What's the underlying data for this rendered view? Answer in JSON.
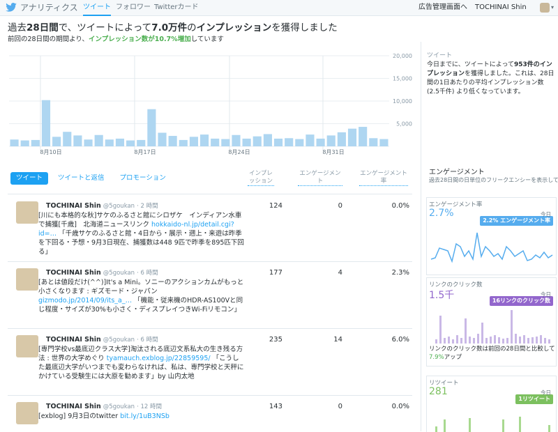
{
  "nav": {
    "brand": "アナリティクス",
    "tabs": [
      "ツイート",
      "フォロワー",
      "Twitterカード"
    ],
    "ads_manager": "広告管理画面へ",
    "user": "TOCHINAI Shin"
  },
  "summary": {
    "prefix": "過去",
    "days": "28日間",
    "middle": "で、ツイートによって",
    "impressions": "7.0万件",
    "middle2": "の",
    "impressions_word": "インプレッション",
    "suffix": "を獲得しました",
    "compare_prefix": "前回の28日間の期間より、",
    "compare_green": "インプレッション数が10.7%増加",
    "compare_suffix": "しています"
  },
  "chart_data": {
    "type": "bar",
    "x_labels": [
      "8月10日",
      "8月17日",
      "8月24日",
      "8月31日"
    ],
    "y_ticks": [
      "20,000",
      "15,000",
      "10,000",
      "5,000"
    ],
    "ylim": [
      0,
      20000
    ],
    "values": [
      1500,
      1300,
      1400,
      10200,
      2100,
      3200,
      2400,
      1500,
      2500,
      1500,
      1700,
      1300,
      1400,
      8200,
      3000,
      2300,
      1400,
      2100,
      2600,
      1700,
      1600,
      2500,
      1700,
      2200,
      2700,
      1700,
      1800,
      1600,
      2600,
      1700,
      2400,
      3100,
      3900,
      4300,
      1800,
      1600
    ],
    "color": "#aed6f1"
  },
  "side_summary": {
    "title": "ツイート",
    "text1": "今日までに、ツイートによって",
    "bold": "953件のインプレッション",
    "text2": "を獲得しました。これは、28日間の1日あたりの平均インプレッション数 (2.5千件) より低くなっています。"
  },
  "tweet_tabs": [
    "ツイート",
    "ツイートと返信",
    "プロモーション"
  ],
  "columns": [
    "インプレッション",
    "エンゲージメント",
    "エンゲージメント率"
  ],
  "tweets": [
    {
      "name": "TOCHINAI Shin",
      "handle": "@5goukan",
      "time": "· 2 時間",
      "text": "[川にも本格的な秋]サケのふるさと館にシロザケ　インディアン水車で捕獲[千歳]　北海道ニュースリンク",
      "link": "hokkaido-nl.jp/detail.cgi?id=…",
      "text2": "「千歳サケのふるさと館・4日から・展示・遡上・来遊は昨季を下回る・予想・9月3日現在、捕獲数は448 9匹で昨季を895匹下回る」",
      "impressions": "124",
      "engagements": "0",
      "rate": "0.0%"
    },
    {
      "name": "TOCHINAI Shin",
      "handle": "@5goukan",
      "time": "· 6 時間",
      "text": "[あとは値段だけ(^^)]It's a Mini。ソニーのアクションカムがもっと小さくなります : ギズモード・ジャパン",
      "link": "gizmodo.jp/2014/09/its_a_…",
      "text2": "「機能・従来機のHDR-AS100Vと同じ程度・サイズが30%も小さく・ディスプレイつきWi-Fiリモコン」",
      "impressions": "177",
      "engagements": "4",
      "rate": "2.3%"
    },
    {
      "name": "TOCHINAI Shin",
      "handle": "@5goukan",
      "time": "· 6 時間",
      "text": "[専門学校vs最底辺クラス大学]淘汰される底辺文系私大の生き残る方法 : 世界の大学めぐり",
      "link": "tyamauch.exblog.jp/22859595/",
      "text2": "「こうした最底辺大学がいつまでも変わらなければ、私は、専門学校と天秤にかけている受験生には大原を勧めます」by 山内太地",
      "impressions": "235",
      "engagements": "14",
      "rate": "6.0%"
    },
    {
      "name": "TOCHINAI Shin",
      "handle": "@5goukan",
      "time": "· 12 時間",
      "text": "[exblog] 9月3日のtwitter",
      "link": "bit.ly/1uB3NSb",
      "text2": "",
      "impressions": "143",
      "engagements": "0",
      "rate": "0.0%"
    }
  ],
  "engagement": {
    "title": "エンゲージメント",
    "subtitle": "過去28日間の日単位のフリークエンシーを表示しています",
    "rate": {
      "title": "エンゲージメント率",
      "value": "2.7%",
      "today": "今日",
      "badge": "2.2% エンゲージメント率",
      "color": "#55acee"
    },
    "clicks": {
      "title": "リンクのクリック数",
      "value": "1.5千",
      "today": "今日",
      "badge": "16リンクのクリック数",
      "color": "#9266cc",
      "note_prefix": "リンクのクリック数は前回の28日間と比較して",
      "note_green": "7.9%",
      "note_suffix": "アップ"
    },
    "retweets": {
      "title": "リツイート",
      "value": "281",
      "today": "今日",
      "badge": "1リツイート",
      "color": "#7cc05f"
    }
  }
}
